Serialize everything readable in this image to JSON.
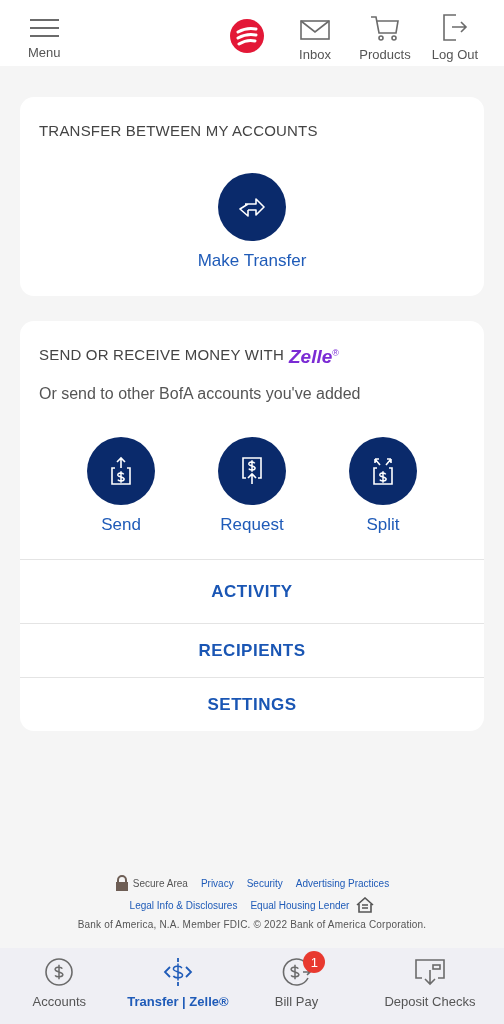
{
  "header": {
    "menu_label": "Menu",
    "actions": [
      {
        "kind": "inbox",
        "label": "Inbox"
      },
      {
        "kind": "products",
        "label": "Products"
      },
      {
        "kind": "logout",
        "label": "Log Out"
      }
    ]
  },
  "transfer_card": {
    "title": "TRANSFER BETWEEN MY ACCOUNTS",
    "action": "Make Transfer"
  },
  "zelle_card": {
    "title": "SEND OR RECEIVE MONEY WITH",
    "brand": "Zelle$^{®}$",
    "subtitle": "Or send to other BofA accounts you've added",
    "actions": [
      {
        "kind": "send",
        "label": "Send"
      },
      {
        "kind": "request",
        "label": "Request"
      },
      {
        "kind": "split",
        "label": "Split"
      }
    ],
    "links": [
      "ACTIVITY",
      "RECIPIENTS",
      "SETTINGS"
    ]
  },
  "footer": {
    "secure": "Secure Area",
    "links_row1": [
      "Privacy",
      "Security",
      "Advertising Practices"
    ],
    "links_row2": [
      "Legal Info & Disclosures",
      "Equal Housing Lender"
    ],
    "legal": "Bank of America, N.A. Member FDIC. © 2022 Bank of America Corporation."
  },
  "tab_bar": [
    {
      "kind": "accounts",
      "label": "Accounts",
      "selected": false
    },
    {
      "kind": "transfer",
      "label": "Transfer | Zelle®",
      "selected": true
    },
    {
      "kind": "billpay",
      "label": "Bill Pay",
      "selected": false,
      "badge": "1"
    },
    {
      "kind": "deposit",
      "label": "Deposit Checks",
      "selected": false
    }
  ]
}
